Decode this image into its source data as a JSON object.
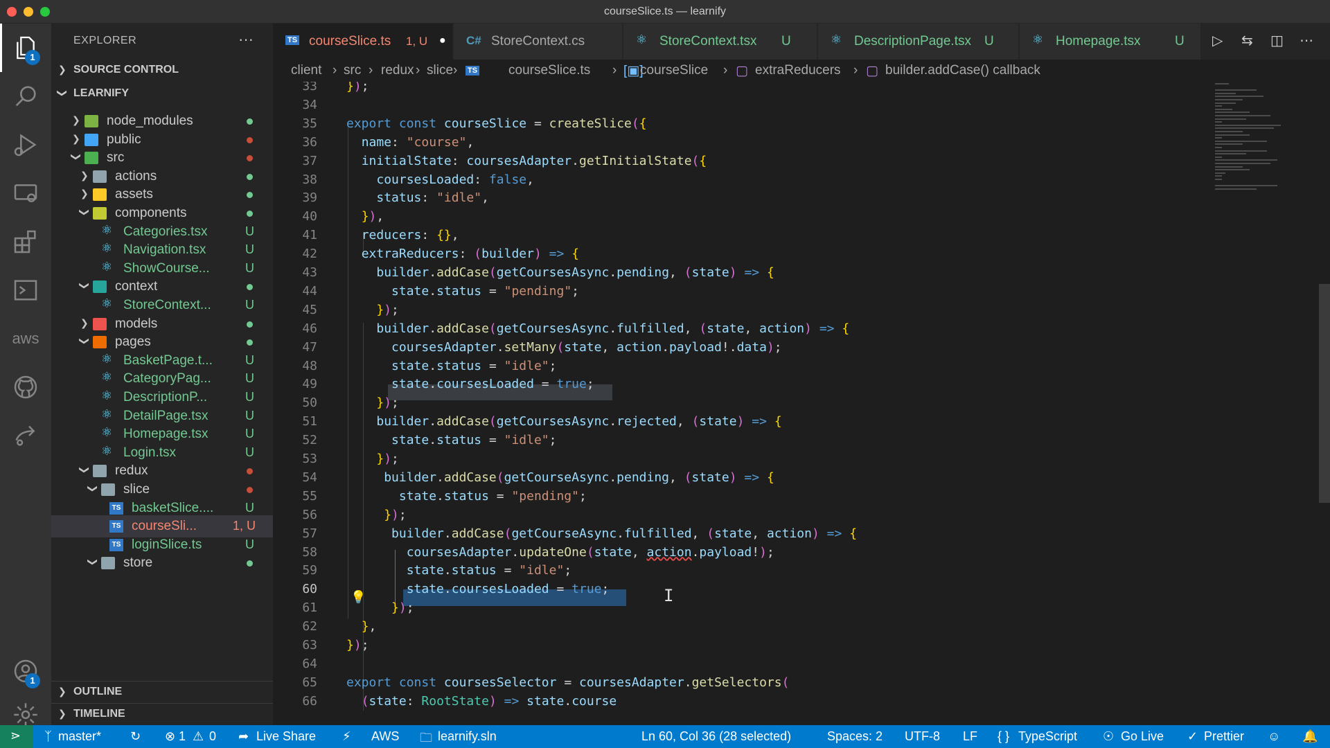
{
  "window": {
    "title": "courseSlice.ts — learnify"
  },
  "activity_bar": {
    "items": [
      "explorer-icon",
      "search-icon",
      "run-debug-icon",
      "remote-explorer-icon",
      "extensions-icon",
      "terminal-icon",
      "aws-icon",
      "github-icon",
      "live-share-icon",
      "accounts-icon",
      "settings-gear-icon"
    ],
    "explorer_badge": "1",
    "accounts_badge": "1",
    "aws_label": "aws"
  },
  "sidebar": {
    "title": "EXPLORER",
    "more": "···",
    "source_control": "SOURCE CONTROL",
    "project": "LEARNIFY",
    "outline": "OUTLINE",
    "timeline": "TIMELINE",
    "tree": [
      {
        "name": "node_modules",
        "kind": "folder",
        "color": "#7cb342",
        "status": ""
      },
      {
        "name": "public",
        "kind": "folder",
        "color": "#42a5f5",
        "status": ""
      },
      {
        "name": "src",
        "kind": "folder",
        "color": "#4caf50",
        "status": ""
      },
      {
        "name": "actions",
        "kind": "folder",
        "color": "#90a4ae",
        "status": ""
      },
      {
        "name": "assets",
        "kind": "folder",
        "color": "#ffca28",
        "status": ""
      },
      {
        "name": "components",
        "kind": "folder",
        "color": "#c0ca33",
        "status": ""
      },
      {
        "name": "Categories.tsx",
        "kind": "react",
        "status": "U"
      },
      {
        "name": "Navigation.tsx",
        "kind": "react",
        "status": "U"
      },
      {
        "name": "ShowCourse...",
        "kind": "react",
        "status": "U"
      },
      {
        "name": "context",
        "kind": "folder",
        "color": "#26a69a",
        "status": ""
      },
      {
        "name": "StoreContext...",
        "kind": "react",
        "status": "U"
      },
      {
        "name": "models",
        "kind": "folder",
        "color": "#ef5350",
        "status": ""
      },
      {
        "name": "pages",
        "kind": "folder",
        "color": "#ef6c00",
        "status": ""
      },
      {
        "name": "BasketPage.t...",
        "kind": "react",
        "status": "U"
      },
      {
        "name": "CategoryPag...",
        "kind": "react",
        "status": "U"
      },
      {
        "name": "DescriptionP...",
        "kind": "react",
        "status": "U"
      },
      {
        "name": "DetailPage.tsx",
        "kind": "react",
        "status": "U"
      },
      {
        "name": "Homepage.tsx",
        "kind": "react",
        "status": "U"
      },
      {
        "name": "Login.tsx",
        "kind": "react",
        "status": "U"
      },
      {
        "name": "redux",
        "kind": "folder",
        "color": "#90a4ae",
        "status": ""
      },
      {
        "name": "slice",
        "kind": "folder",
        "color": "#90a4ae",
        "status": ""
      },
      {
        "name": "basketSlice....",
        "kind": "ts",
        "status": "U"
      },
      {
        "name": "courseSli...",
        "kind": "ts",
        "status": "1, U"
      },
      {
        "name": "loginSlice.ts",
        "kind": "ts",
        "status": "U"
      },
      {
        "name": "store",
        "kind": "folder",
        "color": "#90a4ae",
        "status": ""
      }
    ]
  },
  "tabs": [
    {
      "icon": "TS",
      "label": "courseSlice.ts",
      "status": "1, U",
      "dirty": "●"
    },
    {
      "icon": "C#",
      "label": "StoreContext.cs",
      "status": ""
    },
    {
      "icon": "react",
      "label": "StoreContext.tsx",
      "status": "U"
    },
    {
      "icon": "react",
      "label": "DescriptionPage.tsx",
      "status": "U"
    },
    {
      "icon": "react",
      "label": "Homepage.tsx",
      "status": "U"
    }
  ],
  "breadcrumb": [
    "client",
    "src",
    "redux",
    "slice",
    "courseSlice.ts",
    "courseSlice",
    "extraReducers",
    "builder.addCase() callback"
  ],
  "editor": {
    "line_numbers": [
      "33",
      "34",
      "35",
      "36",
      "37",
      "38",
      "39",
      "40",
      "41",
      "42",
      "43",
      "44",
      "45",
      "46",
      "47",
      "48",
      "49",
      "50",
      "51",
      "52",
      "53",
      "54",
      "55",
      "56",
      "57",
      "58",
      "59",
      "60",
      "61",
      "62",
      "63",
      "64",
      "65",
      "66"
    ],
    "lines": [
      "});",
      "",
      "export const courseSlice = createSlice({",
      "  name: \"course\",",
      "  initialState: coursesAdapter.getInitialState({",
      "    coursesLoaded: false,",
      "    status: \"idle\",",
      "  }),",
      "  reducers: {},",
      "  extraReducers: (builder) => {",
      "    builder.addCase(getCoursesAsync.pending, (state) => {",
      "      state.status = \"pending\";",
      "    });",
      "    builder.addCase(getCoursesAsync.fulfilled, (state, action) => {",
      "      coursesAdapter.setMany(state, action.payload!.data);",
      "      state.status = \"idle\";",
      "      state.coursesLoaded = true;",
      "    });",
      "    builder.addCase(getCoursesAsync.rejected, (state) => {",
      "      state.status = \"idle\";",
      "    });",
      "     builder.addCase(getCourseAsync.pending, (state) => {",
      "       state.status = \"pending\";",
      "     });",
      "      builder.addCase(getCourseAsync.fulfilled, (state, action) => {",
      "        coursesAdapter.updateOne(state, action.payload!);",
      "        state.status = \"idle\";",
      "        state.coursesLoaded = true;",
      "      });",
      "  },",
      "});",
      "",
      "export const coursesSelector = coursesAdapter.getSelectors(",
      "  (state: RootState) => state.course"
    ]
  },
  "statusbar": {
    "branch": "master*",
    "problems_errors": "1",
    "problems_warnings": "0",
    "live_share": "Live Share",
    "aws": "AWS",
    "solution": "learnify.sln",
    "cursor": "Ln 60, Col 36 (28 selected)",
    "spaces": "Spaces: 2",
    "encoding": "UTF-8",
    "eol": "LF",
    "language": "TypeScript",
    "go_live": "Go Live",
    "prettier": "Prettier"
  }
}
